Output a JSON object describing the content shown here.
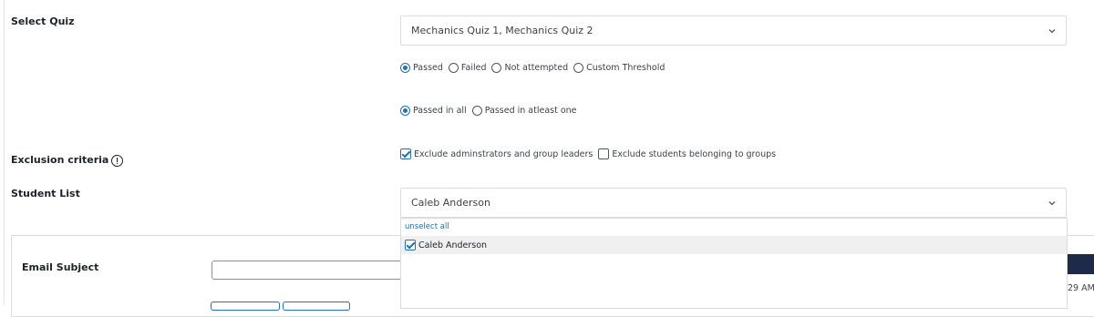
{
  "labels": {
    "select_quiz": "Select Quiz",
    "exclusion_criteria": "Exclusion criteria",
    "student_list": "Student List",
    "email_subject": "Email Subject"
  },
  "quiz_select": {
    "value": "Mechanics Quiz 1, Mechanics Quiz 2"
  },
  "status_options": {
    "selected": "Passed",
    "items": [
      "Passed",
      "Failed",
      "Not attempted",
      "Custom Threshold"
    ]
  },
  "pass_scope": {
    "selected": "Passed in all",
    "items": [
      "Passed in all",
      "Passed in atleast one"
    ]
  },
  "exclusions": [
    {
      "label": "Exclude adminstrators and group leaders",
      "checked": true
    },
    {
      "label": "Exclude students belonging to groups",
      "checked": false
    }
  ],
  "student_select": {
    "value": "Caleb Anderson"
  },
  "student_dropdown": {
    "unselect_all": "unselect all",
    "items": [
      {
        "label": "Caleb Anderson",
        "checked": true
      }
    ]
  },
  "email_subject_input": {
    "value": ""
  },
  "time_fragment": "29 AM",
  "icons": {
    "chevron": "chevron-down-icon",
    "info": "info-icon"
  }
}
